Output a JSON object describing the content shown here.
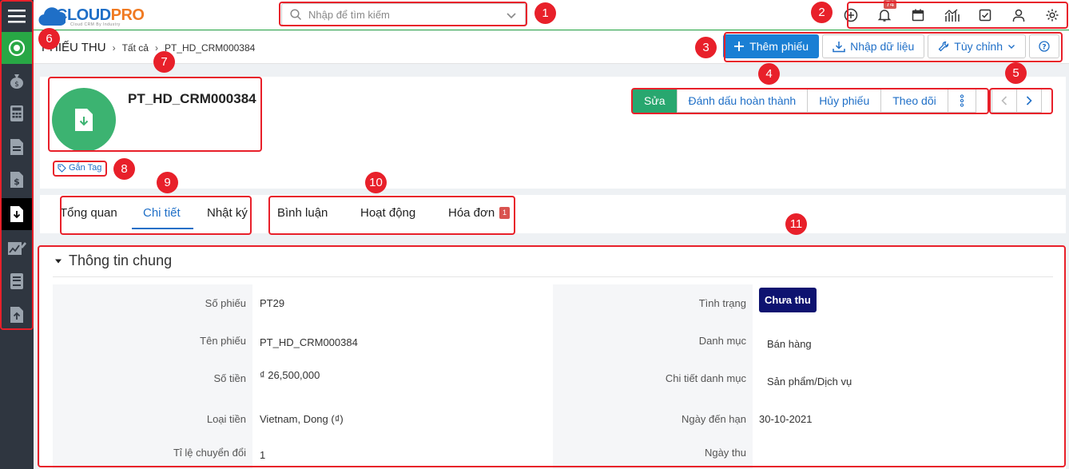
{
  "logo": {
    "part1": "CLOUD",
    "part2": "PRO",
    "subtitle": "Cloud CRM By Industry"
  },
  "search": {
    "placeholder": "Nhập để tìm kiếm"
  },
  "notifications": {
    "count": "74"
  },
  "sidebar": {
    "items": [
      {
        "icon": "menu-icon"
      },
      {
        "icon": "dashboard-icon"
      },
      {
        "icon": "money-bag-icon"
      },
      {
        "icon": "calculator-icon"
      },
      {
        "icon": "document-icon"
      },
      {
        "icon": "invoice-icon"
      },
      {
        "icon": "receipt-download-icon"
      },
      {
        "icon": "chart-edit-icon"
      },
      {
        "icon": "book-icon"
      },
      {
        "icon": "upload-icon"
      }
    ]
  },
  "breadcrumb": {
    "module": "PHIẾU THU",
    "filter": "Tất cả",
    "record": "PT_HD_CRM000384"
  },
  "toolbar": {
    "add_label": "Thêm phiếu",
    "import_label": "Nhập dữ liệu",
    "customize_label": "Tùy chỉnh"
  },
  "record": {
    "title": "PT_HD_CRM000384",
    "tag_label": "Gắn Tag",
    "actions": {
      "edit": "Sửa",
      "mark_done": "Đánh dấu hoàn thành",
      "cancel": "Hủy phiếu",
      "follow": "Theo dõi"
    }
  },
  "tabs": {
    "left": [
      "Tổng quan",
      "Chi tiết",
      "Nhật ký"
    ],
    "right": [
      "Bình luận",
      "Hoạt động",
      "Hóa đơn"
    ],
    "invoice_badge": "1",
    "active": "Chi tiết"
  },
  "details": {
    "section_title": "Thông tin chung",
    "left": [
      {
        "label": "Số phiếu",
        "value": "PT29"
      },
      {
        "label": "Tên phiếu",
        "value": "PT_HD_CRM000384"
      },
      {
        "label": "Số tiền",
        "value": "₫ 26,500,000"
      },
      {
        "label": "Loại tiền",
        "value": "Vietnam, Dong (₫)"
      },
      {
        "label": "Tỉ lệ chuyển đổi",
        "value": "1"
      }
    ],
    "right": [
      {
        "label": "Tình trạng",
        "value": "Chưa thu"
      },
      {
        "label": "Danh mục",
        "value": "Bán hàng"
      },
      {
        "label": "Chi tiết danh mục",
        "value": "Sản phẩm/Dịch vụ"
      },
      {
        "label": "Ngày đến hạn",
        "value": "30-10-2021"
      },
      {
        "label": "Ngày thu",
        "value": ""
      }
    ]
  },
  "annotations": [
    "1",
    "2",
    "3",
    "4",
    "5",
    "6",
    "7",
    "8",
    "9",
    "10",
    "11"
  ],
  "colors": {
    "primary": "#1a7fd4",
    "edit_green": "#28a76f",
    "avatar_green": "#3cb371",
    "status_navy": "#0e1370",
    "annotation_red": "#e8202a",
    "sidebar_bg": "#2f3640"
  }
}
